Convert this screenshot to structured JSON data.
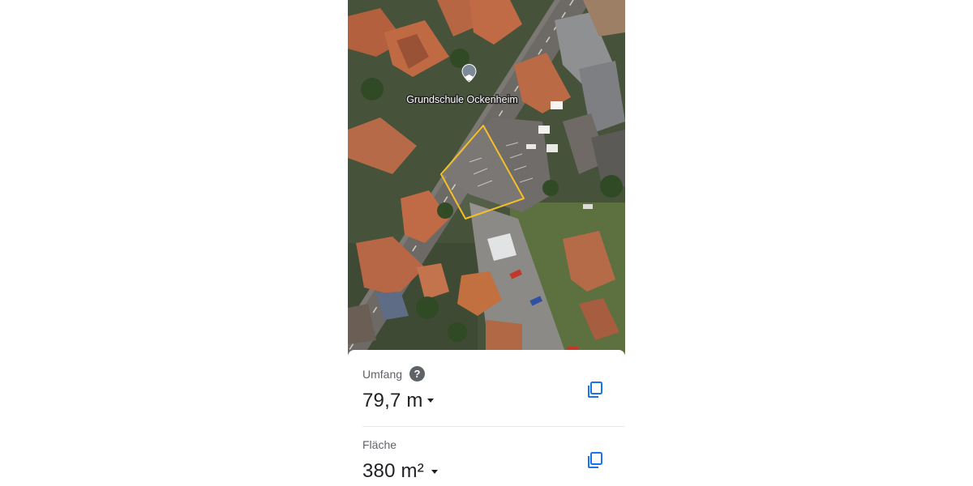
{
  "map": {
    "poi_label": "Grundschule Ockenheim",
    "poi_icon": "school-pin-icon",
    "outline_color": "#f6c026"
  },
  "measurements": {
    "perimeter": {
      "label": "Umfang",
      "help": "?",
      "value": "79,7 m",
      "help_icon": "help-icon",
      "unit_dropdown_icon": "caret-down-icon",
      "copy_icon": "copy-icon"
    },
    "area": {
      "label": "Fläche",
      "value": "380 m²",
      "unit_dropdown_icon": "caret-down-icon",
      "copy_icon": "copy-icon"
    }
  },
  "colors": {
    "accent": "#1a73e8",
    "text_primary": "#202124",
    "text_secondary": "#5f6368"
  }
}
